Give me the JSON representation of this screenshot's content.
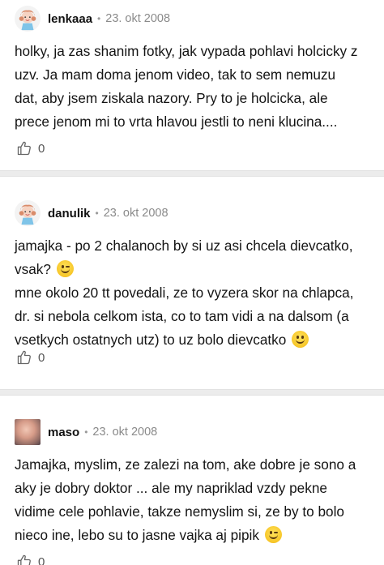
{
  "comments": [
    {
      "author": "lenkaaa",
      "separator": "•",
      "date": "23. okt 2008",
      "avatar_icon": "girl-doll-avatar-icon",
      "lines": [
        "holky, ja zas shanim fotky, jak vypada pohlavi holcicky z",
        "uzv. Ja mam doma jenom video, tak to sem nemuzu",
        "dat, aby jsem ziskala nazory. Pry to je holcicka, ale",
        "prece jenom mi to vrta hlavou jestli to neni klucina...."
      ],
      "likes": "0"
    },
    {
      "author": "danulik",
      "separator": "•",
      "date": "23. okt 2008",
      "avatar_icon": "girl-doll-avatar-icon",
      "lines": [
        "jamajka - po 2 chalanoch by si uz asi chcela dievcatko,",
        "vsak?",
        "mne okolo 20 tt povedali, ze to vyzera skor na chlapca,",
        "dr. si nebola celkom ista, co to tam vidi a na dalsom (a",
        "vsetkych ostatnych utz) to uz bolo dievcatko"
      ],
      "emojis": [
        "wink-emoji",
        "smile-emoji"
      ],
      "likes": "0"
    },
    {
      "author": "maso",
      "separator": "•",
      "date": "23. okt 2008",
      "avatar_icon": "user-photo-avatar",
      "lines": [
        "Jamajka, myslim, ze zalezi na tom, ake dobre je sono a",
        "aky je dobry doktor ... ale my napriklad vzdy pekne",
        "vidime cele pohlavie, takze nemyslim si, ze by to bolo",
        "nieco ine, lebo su to jasne vajka aj pipik"
      ],
      "emojis": [
        "wink-emoji"
      ],
      "likes": "0"
    }
  ],
  "icons": {
    "like": "thumbs-up-icon"
  }
}
